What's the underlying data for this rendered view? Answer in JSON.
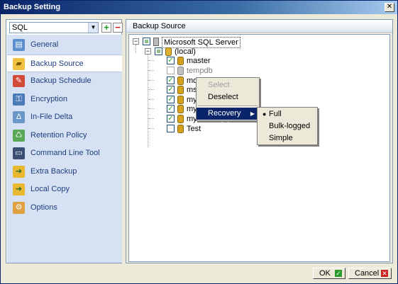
{
  "window": {
    "title": "Backup Setting",
    "close_symbol": "✕"
  },
  "profile": {
    "selected": "SQL",
    "dropdown_symbol": "▼",
    "add_symbol": "+",
    "remove_symbol": "−"
  },
  "nav": {
    "items": [
      {
        "label": "General",
        "icon": "general-icon"
      },
      {
        "label": "Backup Source",
        "icon": "folder-icon"
      },
      {
        "label": "Backup Schedule",
        "icon": "schedule-icon"
      },
      {
        "label": "Encryption",
        "icon": "encryption-icon"
      },
      {
        "label": "In-File Delta",
        "icon": "delta-icon"
      },
      {
        "label": "Retention Policy",
        "icon": "retention-icon"
      },
      {
        "label": "Command Line Tool",
        "icon": "terminal-icon"
      },
      {
        "label": "Extra Backup",
        "icon": "extra-backup-icon"
      },
      {
        "label": "Local Copy",
        "icon": "local-copy-icon"
      },
      {
        "label": "Options",
        "icon": "options-icon"
      }
    ],
    "active_index": 1
  },
  "source": {
    "header": "Backup Source",
    "tree": {
      "server": "Microsoft SQL Server",
      "instance": "(local)",
      "databases": [
        {
          "name": "master",
          "checked": true
        },
        {
          "name": "tempdb",
          "checked": false,
          "disabled": true
        },
        {
          "name": "model",
          "checked": true
        },
        {
          "name": "msdb",
          "checked": true
        },
        {
          "name": "my",
          "checked": true
        },
        {
          "name": "my",
          "checked": true
        },
        {
          "name": "my",
          "checked": true
        },
        {
          "name": "Test",
          "checked": false
        }
      ]
    }
  },
  "context_menu": {
    "items": [
      {
        "label": "Select",
        "disabled": true
      },
      {
        "label": "Deselect",
        "disabled": false
      },
      {
        "label": "Recovery model",
        "submenu": true,
        "highlighted": true
      }
    ],
    "submenu_arrow": "▶",
    "submenu": {
      "items": [
        {
          "label": "Full",
          "selected": true
        },
        {
          "label": "Bulk-logged",
          "selected": false
        },
        {
          "label": "Simple",
          "selected": false
        }
      ],
      "selected_bullet": "●"
    }
  },
  "buttons": {
    "ok": "OK",
    "cancel": "Cancel",
    "ok_symbol": "✓",
    "cancel_symbol": "✕"
  },
  "colors": {
    "title_bar": "#0a246a",
    "nav_bg": "#d6e2f3",
    "nav_text": "#1e3e7e",
    "menu_highlight": "#0a246a",
    "check": "#21a121"
  }
}
